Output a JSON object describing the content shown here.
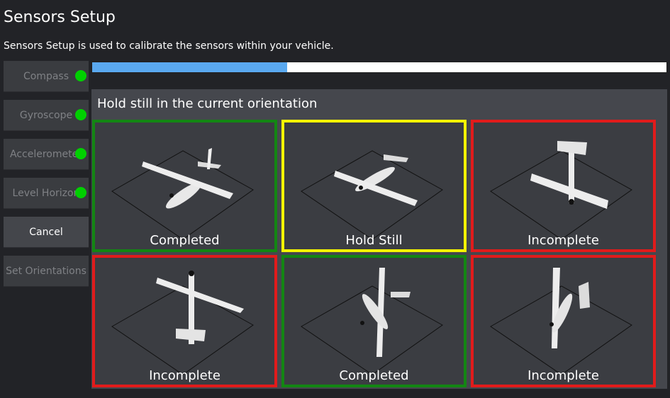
{
  "header": {
    "title": "Sensors Setup",
    "subtitle": "Sensors Setup is used to calibrate the sensors within your vehicle."
  },
  "sidebar": {
    "items": [
      {
        "label": "Compass",
        "status": "green",
        "active": false
      },
      {
        "label": "Gyroscope",
        "status": "green",
        "active": false
      },
      {
        "label": "Accelerometer",
        "status": "green",
        "active": false
      },
      {
        "label": "Level Horizon",
        "status": "green",
        "active": false
      },
      {
        "label": "Cancel",
        "status": null,
        "active": true
      },
      {
        "label": "Set Orientations",
        "status": null,
        "active": false
      }
    ]
  },
  "progress": {
    "value": 0.34
  },
  "calibration": {
    "instruction": "Hold still in the current orientation",
    "cells": [
      {
        "label": "Completed",
        "state": "completed",
        "orientation": "level"
      },
      {
        "label": "Hold Still",
        "state": "holding",
        "orientation": "inverted"
      },
      {
        "label": "Incomplete",
        "state": "incomplete",
        "orientation": "nose-down"
      },
      {
        "label": "Incomplete",
        "state": "incomplete",
        "orientation": "nose-up"
      },
      {
        "label": "Completed",
        "state": "completed",
        "orientation": "left-wing-down"
      },
      {
        "label": "Incomplete",
        "state": "incomplete",
        "orientation": "right-wing-down"
      }
    ]
  },
  "colors": {
    "completed": "#138613",
    "holding": "#f5f500",
    "incomplete": "#e11b1b",
    "status_green": "#00d000",
    "progress_fill": "#5aa9f0"
  }
}
